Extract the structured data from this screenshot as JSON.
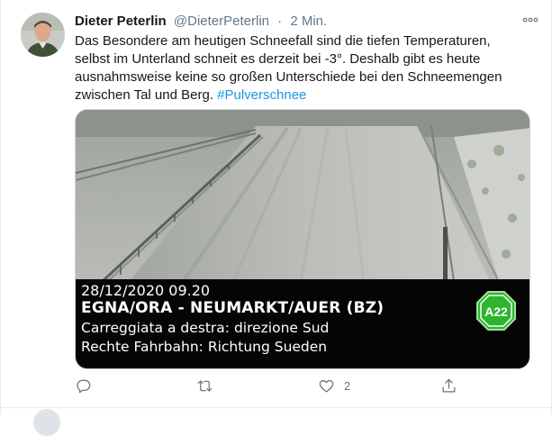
{
  "tweet": {
    "author_name": "Dieter Peterlin",
    "author_handle": "@DieterPeterlin",
    "separator": "·",
    "timestamp": "2 Min.",
    "text": "Das Besondere am heutigen Schneefall sind die tiefen Temperaturen, selbst im Unterland schneit es derzeit bei -3°. Deshalb gibt es heute ausnahmsweise keine so großen Unterschiede bei den Schneemengen zwischen Tal und Berg. ",
    "hashtag": "#Pulverschnee",
    "more_icon": "more-horizontal-icon"
  },
  "media": {
    "camera_datetime": "28/12/2020  09.20",
    "camera_location": "EGNA/ORA - NEUMARKT/AUER (BZ)",
    "camera_line_it": "Carreggiata a destra: direzione Sud",
    "camera_line_de": "Rechte Fahrbahn: Richtung Sueden",
    "logo_text": "A22",
    "logo_color": "#2db52d"
  },
  "actions": {
    "reply_icon": "reply-icon",
    "retweet_icon": "retweet-icon",
    "like_icon": "heart-icon",
    "like_count": "2",
    "share_icon": "share-icon"
  },
  "colors": {
    "link": "#1b95e0",
    "secondary_text": "#657786",
    "primary_text": "#14171a"
  }
}
